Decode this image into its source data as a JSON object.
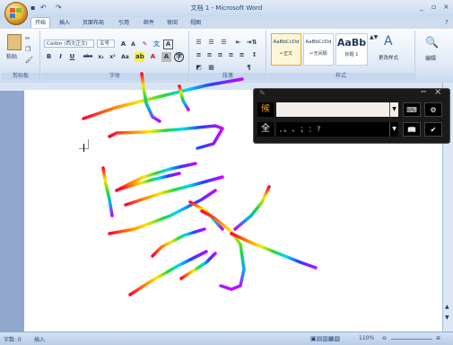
{
  "window": {
    "title": "文档 1 - Microsoft Word",
    "minimize": "_",
    "restore": "▫",
    "close": "×"
  },
  "quick_access": {
    "save": "▪",
    "undo": "↶",
    "redo": "↷"
  },
  "tabs": [
    "开始",
    "插入",
    "页面布局",
    "引用",
    "邮件",
    "审阅",
    "视图"
  ],
  "ribbon": {
    "clipboard": {
      "paste_label": "粘贴",
      "group_label": "剪贴板"
    },
    "font": {
      "font_name": "Calibri (西文正文)",
      "font_size": "五号",
      "group_label": "字体",
      "buttons": [
        "B",
        "I",
        "U",
        "abe",
        "x₂",
        "x²",
        "Aa"
      ]
    },
    "paragraph": {
      "group_label": "段落"
    },
    "styles": {
      "group_label": "样式",
      "items": [
        {
          "sample": "AaBbCcDd",
          "name": "↵正文"
        },
        {
          "sample": "AaBbCcDd",
          "name": "↵无间隔"
        },
        {
          "sample": "AaBb",
          "name": "标题 1"
        }
      ],
      "change_styles": "更改样式"
    },
    "editing": {
      "label": "编辑"
    }
  },
  "ime": {
    "candidate_label": "候",
    "full_label": "全",
    "punctuation": ", 。 、 ； ： ？",
    "icons": [
      "keyboard-icon",
      "settings-icon",
      "book-icon",
      "check-icon"
    ]
  },
  "statusbar": {
    "word_count": "字数: 0",
    "insert_mode": "插入",
    "zoom": "110%"
  },
  "colors": {
    "ribbon": "#dfe9f6",
    "frame": "#6d89b6",
    "ime_bg": "#1a1a1a"
  }
}
